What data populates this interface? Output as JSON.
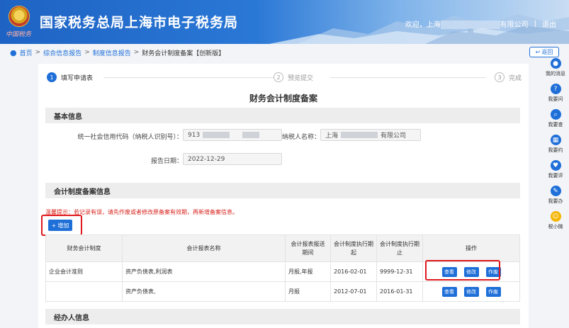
{
  "header": {
    "emblem_caption": "中国税务",
    "title": "国家税务总局上海市电子税务局",
    "welcome": "欢迎，上海",
    "company_suffix": "有限公司",
    "logout": "退出"
  },
  "breadcrumb": {
    "items": [
      "首页",
      "综合信息报告",
      "制度信息报告",
      "财务会计制度备案【创新版】"
    ],
    "back_label": "返回"
  },
  "steps": [
    {
      "num": "1",
      "label": "填写申请表"
    },
    {
      "num": "2",
      "label": "预览提交"
    },
    {
      "num": "3",
      "label": "完成"
    }
  ],
  "form_title": "财务会计制度备案",
  "sections": {
    "basic": "基本信息",
    "accounting": "会计制度备案信息",
    "handler": "经办人信息"
  },
  "basic_info": {
    "credit_code_label": "统一社会信用代码（纳税人识别号）：",
    "credit_code_value": "913",
    "taxpayer_name_label": "纳税人名称：",
    "taxpayer_name_value": "上海",
    "taxpayer_name_suffix": "有限公司",
    "report_date_label": "报告日期：",
    "report_date_value": "2022-12-29"
  },
  "warning": "温馨提示：若记录有误，请先作废或者修改原备案有效期，再新增备案信息。",
  "add_button": "增加",
  "table": {
    "headers": [
      "财务会计制度",
      "会计报表名称",
      "会计报表报送期间",
      "会计制度执行期起",
      "会计制度执行期止",
      "操作"
    ],
    "rows": [
      {
        "system": "企业会计准则",
        "report": "资产负债表,利润表",
        "period": "月报,年报",
        "start": "2016-02-01",
        "end": "9999-12-31"
      },
      {
        "system": "",
        "report": "资产负债表,",
        "period": "月报",
        "start": "2012-07-01",
        "end": "2016-01-31"
      }
    ],
    "ops": [
      "查看",
      "修改",
      "作废"
    ]
  },
  "right_toolbar": [
    "我的消息",
    "我要问",
    "我要查",
    "我要约",
    "我要评",
    "我要办",
    "税小微"
  ],
  "colors": {
    "primary": "#1f6fd8",
    "warning": "#d8231c",
    "highlight": "#e0191c"
  }
}
